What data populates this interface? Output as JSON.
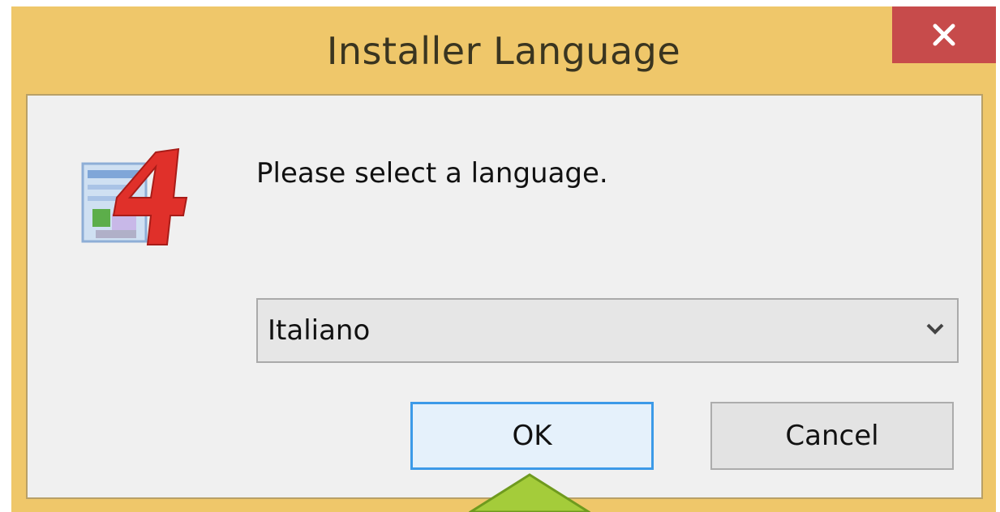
{
  "window": {
    "title": "Installer Language",
    "close_glyph": "✕"
  },
  "dialog": {
    "prompt": "Please select a language.",
    "language_select": {
      "selected": "Italiano"
    },
    "buttons": {
      "ok_label": "OK",
      "cancel_label": "Cancel"
    }
  },
  "icons": {
    "app": "installer-app-icon",
    "close": "close-icon",
    "dropdown": "chevron-down-icon",
    "pointer": "pointer-arrow-icon"
  },
  "colors": {
    "title_bar": "#efc76a",
    "close_button": "#c74b4b",
    "focus_border": "#3c9ae8",
    "pointer": "#a4cc3a"
  }
}
